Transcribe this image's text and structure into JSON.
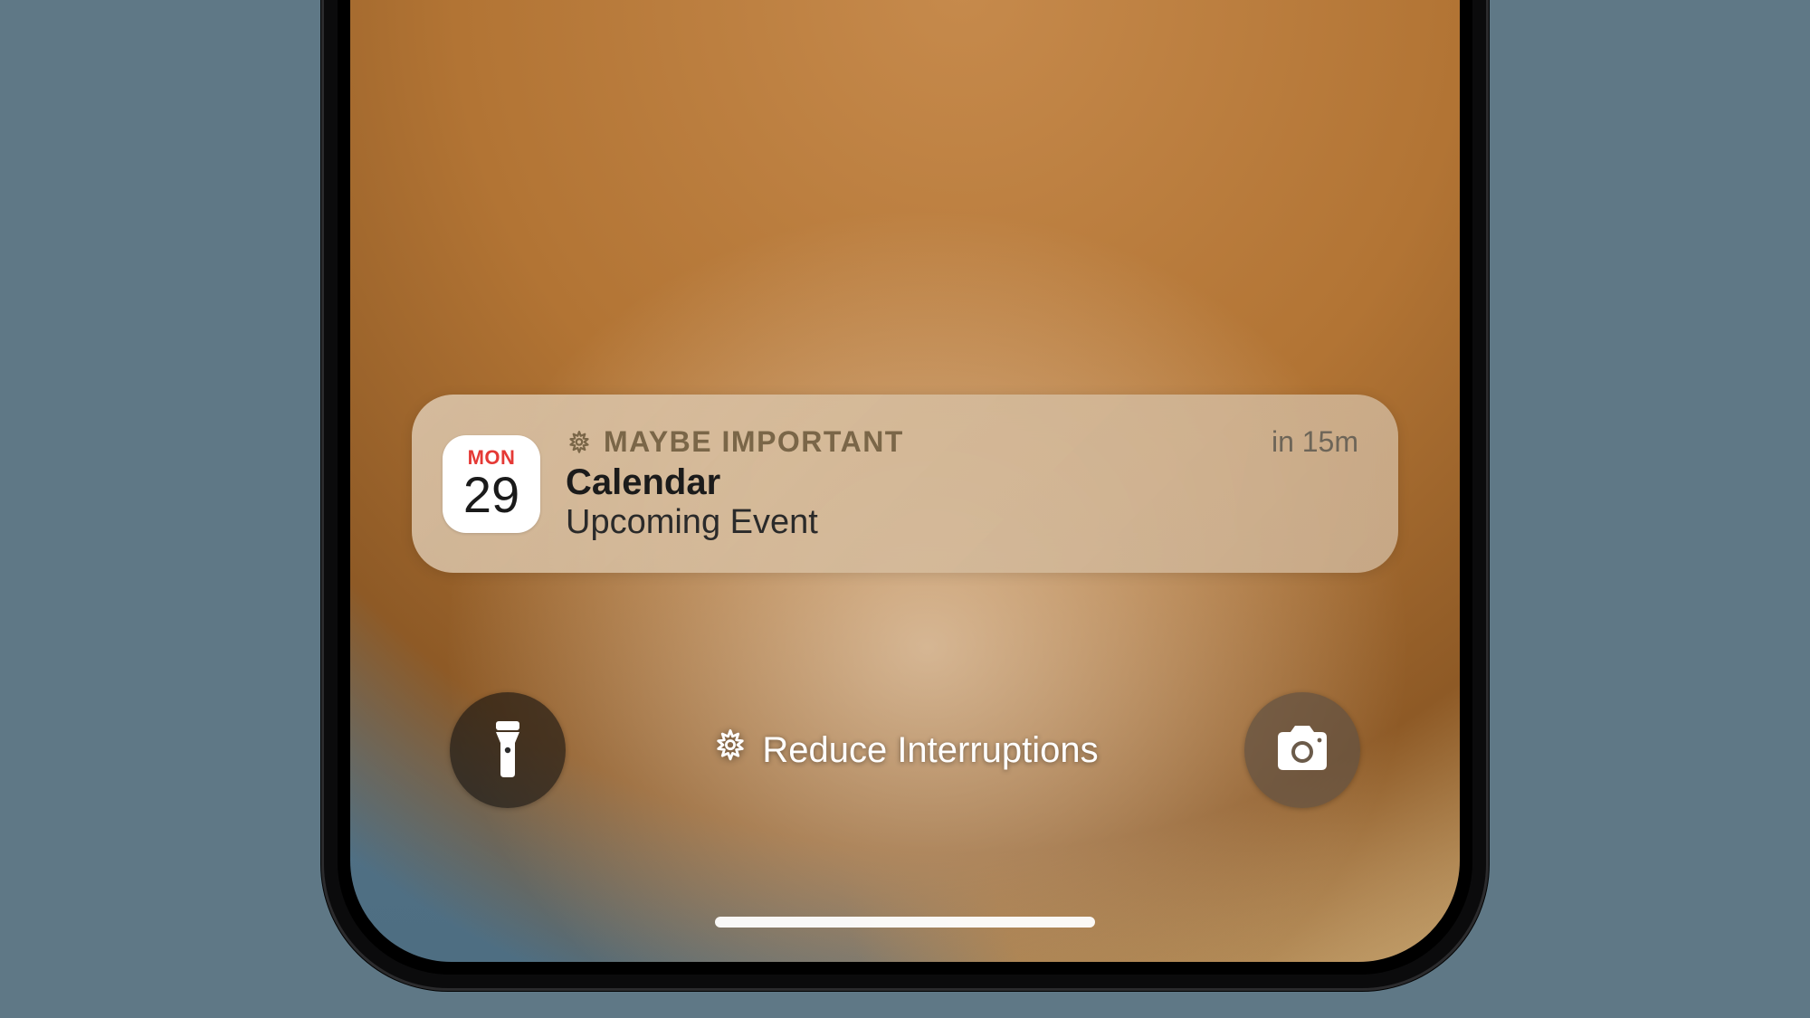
{
  "notification": {
    "priority_label": "MAYBE IMPORTANT",
    "time_until": "in 15m",
    "app_name": "Calendar",
    "subtitle": "Upcoming Event",
    "calendar_icon": {
      "day_of_week": "MON",
      "date": "29"
    }
  },
  "lockscreen": {
    "focus_label": "Reduce Interruptions"
  },
  "colors": {
    "page_bg": "#5f7886",
    "priority_text": "#7a6648",
    "cal_dow_red": "#e53935"
  }
}
